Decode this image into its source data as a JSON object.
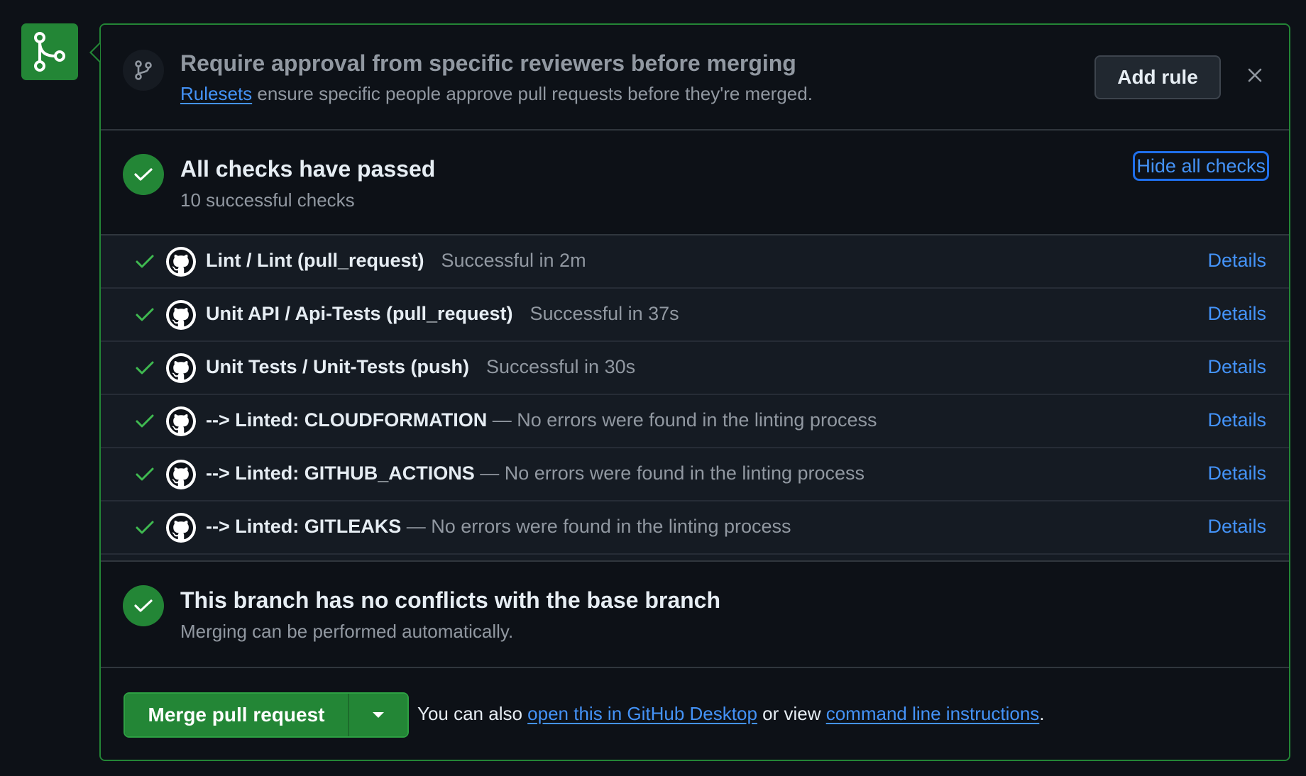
{
  "ruleset": {
    "title": "Require approval from specific reviewers before merging",
    "link_text": "Rulesets",
    "description": " ensure specific people approve pull requests before they're merged.",
    "add_rule_label": "Add rule",
    "close_icon": "close-icon"
  },
  "checks_summary": {
    "title": "All checks have passed",
    "subtitle": "10 successful checks",
    "hide_label": "Hide all checks"
  },
  "checks": [
    {
      "name": "Lint / Lint (pull_request)",
      "separator": "",
      "status": "Successful in 2m",
      "details": "Details"
    },
    {
      "name": "Unit API / Api-Tests (pull_request)",
      "separator": "",
      "status": "Successful in 37s",
      "details": "Details"
    },
    {
      "name": "Unit Tests / Unit-Tests (push)",
      "separator": "",
      "status": "Successful in 30s",
      "details": "Details"
    },
    {
      "name": "--> Linted: CLOUDFORMATION",
      "separator": " — ",
      "status": "No errors were found in the linting process",
      "details": "Details"
    },
    {
      "name": "--> Linted: GITHUB_ACTIONS",
      "separator": " — ",
      "status": "No errors were found in the linting process",
      "details": "Details"
    },
    {
      "name": "--> Linted: GITLEAKS",
      "separator": " — ",
      "status": "No errors were found in the linting process",
      "details": "Details"
    }
  ],
  "conflicts": {
    "title": "This branch has no conflicts with the base branch",
    "subtitle": "Merging can be performed automatically."
  },
  "merge": {
    "button_label": "Merge pull request",
    "note_prefix": "You can also ",
    "desktop_link": "open this in GitHub Desktop",
    "note_middle": " or view ",
    "cli_link": "command line instructions",
    "note_suffix": "."
  },
  "colors": {
    "success": "#238636",
    "link": "#4493f8",
    "border": "#30363d"
  }
}
